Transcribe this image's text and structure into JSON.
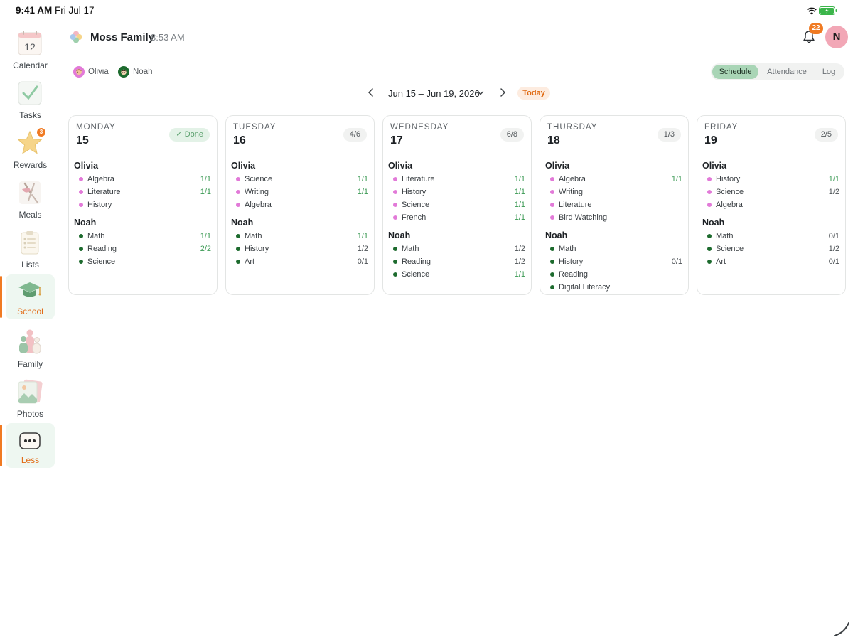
{
  "status_bar": {
    "time": "9:41 AM",
    "date": "Fri Jul 17"
  },
  "header": {
    "family_name": "Moss Family",
    "time": "8:53 AM",
    "notification_count": "22",
    "user_initial": "N"
  },
  "sidebar": {
    "items": [
      {
        "label": "Calendar",
        "icon": "calendar-icon",
        "calendar_day": "12",
        "active": false
      },
      {
        "label": "Tasks",
        "icon": "tasks-icon",
        "active": false
      },
      {
        "label": "Rewards",
        "icon": "star-icon",
        "badge": "3",
        "active": false
      },
      {
        "label": "Meals",
        "icon": "meals-icon",
        "active": false
      },
      {
        "label": "Lists",
        "icon": "lists-icon",
        "active": false
      },
      {
        "label": "School",
        "icon": "graduation-cap-icon",
        "active": true
      },
      {
        "label": "Family",
        "icon": "family-icon",
        "active": false
      },
      {
        "label": "Photos",
        "icon": "photos-icon",
        "active": false
      },
      {
        "label": "Less",
        "icon": "more-icon",
        "active": true
      }
    ]
  },
  "children": [
    {
      "name": "Olivia",
      "color": "#e27ad8"
    },
    {
      "name": "Noah",
      "color": "#1d6b2e"
    }
  ],
  "view_tabs": [
    {
      "label": "Schedule",
      "active": true
    },
    {
      "label": "Attendance",
      "active": false
    },
    {
      "label": "Log",
      "active": false
    }
  ],
  "date_nav": {
    "range": "Jun 15 – Jun 19, 2026",
    "today_label": "Today"
  },
  "colors": {
    "accent": "#f07a22",
    "olivia_dot": "#e27ad8",
    "noah_dot": "#1d6b2e",
    "complete_green": "#3c9a55"
  },
  "days": [
    {
      "name": "MONDAY",
      "number": "15",
      "badge": "✓ Done",
      "done": true,
      "kids": [
        {
          "name": "Olivia",
          "subjects": [
            {
              "name": "Algebra",
              "value": "1/1",
              "complete": true
            },
            {
              "name": "Literature",
              "value": "1/1",
              "complete": true
            },
            {
              "name": "History",
              "value": "",
              "complete": false
            }
          ]
        },
        {
          "name": "Noah",
          "subjects": [
            {
              "name": "Math",
              "value": "1/1",
              "complete": true
            },
            {
              "name": "Reading",
              "value": "2/2",
              "complete": true
            },
            {
              "name": "Science",
              "value": "",
              "complete": false
            }
          ]
        }
      ]
    },
    {
      "name": "TUESDAY",
      "number": "16",
      "badge": "4/6",
      "done": false,
      "kids": [
        {
          "name": "Olivia",
          "subjects": [
            {
              "name": "Science",
              "value": "1/1",
              "complete": true
            },
            {
              "name": "Writing",
              "value": "1/1",
              "complete": true
            },
            {
              "name": "Algebra",
              "value": "",
              "complete": false
            }
          ]
        },
        {
          "name": "Noah",
          "subjects": [
            {
              "name": "Math",
              "value": "1/1",
              "complete": true
            },
            {
              "name": "History",
              "value": "1/2",
              "complete": false
            },
            {
              "name": "Art",
              "value": "0/1",
              "complete": false
            }
          ]
        }
      ]
    },
    {
      "name": "WEDNESDAY",
      "number": "17",
      "badge": "6/8",
      "done": false,
      "kids": [
        {
          "name": "Olivia",
          "subjects": [
            {
              "name": "Literature",
              "value": "1/1",
              "complete": true
            },
            {
              "name": "History",
              "value": "1/1",
              "complete": true
            },
            {
              "name": "Science",
              "value": "1/1",
              "complete": true
            },
            {
              "name": "French",
              "value": "1/1",
              "complete": true
            }
          ]
        },
        {
          "name": "Noah",
          "subjects": [
            {
              "name": "Math",
              "value": "1/2",
              "complete": false
            },
            {
              "name": "Reading",
              "value": "1/2",
              "complete": false
            },
            {
              "name": "Science",
              "value": "1/1",
              "complete": true
            }
          ]
        }
      ]
    },
    {
      "name": "THURSDAY",
      "number": "18",
      "badge": "1/3",
      "done": false,
      "kids": [
        {
          "name": "Olivia",
          "subjects": [
            {
              "name": "Algebra",
              "value": "1/1",
              "complete": true
            },
            {
              "name": "Writing",
              "value": "",
              "complete": false
            },
            {
              "name": "Literature",
              "value": "",
              "complete": false
            },
            {
              "name": "Bird Watching",
              "value": "",
              "complete": false
            }
          ]
        },
        {
          "name": "Noah",
          "subjects": [
            {
              "name": "Math",
              "value": "",
              "complete": false
            },
            {
              "name": "History",
              "value": "0/1",
              "complete": false
            },
            {
              "name": "Reading",
              "value": "",
              "complete": false
            },
            {
              "name": "Digital Literacy",
              "value": "",
              "complete": false
            }
          ]
        }
      ]
    },
    {
      "name": "FRIDAY",
      "number": "19",
      "badge": "2/5",
      "done": false,
      "kids": [
        {
          "name": "Olivia",
          "subjects": [
            {
              "name": "History",
              "value": "1/1",
              "complete": true
            },
            {
              "name": "Science",
              "value": "1/2",
              "complete": false
            },
            {
              "name": "Algebra",
              "value": "",
              "complete": false
            }
          ]
        },
        {
          "name": "Noah",
          "subjects": [
            {
              "name": "Math",
              "value": "0/1",
              "complete": false
            },
            {
              "name": "Science",
              "value": "1/2",
              "complete": false
            },
            {
              "name": "Art",
              "value": "0/1",
              "complete": false
            }
          ]
        }
      ]
    }
  ]
}
